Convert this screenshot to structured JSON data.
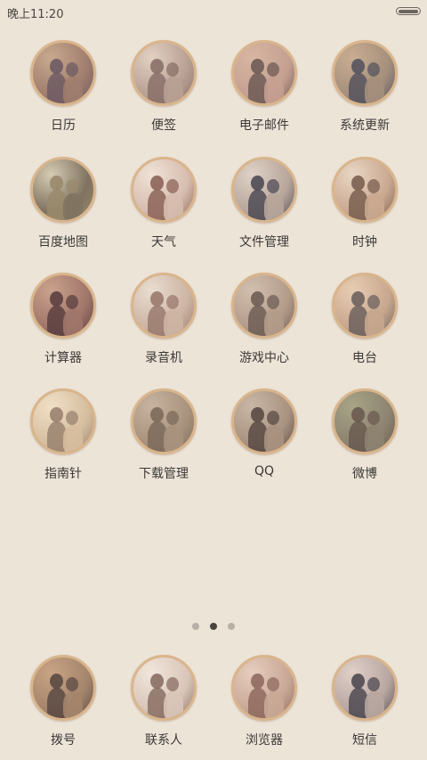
{
  "status_bar": {
    "time": "晚上11:20"
  },
  "pages": {
    "count": 3,
    "active": 1
  },
  "apps": [
    {
      "label": "日历",
      "tint": [
        "#c8a98e",
        "#6d5a63",
        "#a07d6e"
      ]
    },
    {
      "label": "便签",
      "tint": [
        "#e2d1c2",
        "#8a7068",
        "#b89f93"
      ]
    },
    {
      "label": "电子邮件",
      "tint": [
        "#d7b6a2",
        "#6e5b56",
        "#c5a091"
      ]
    },
    {
      "label": "系统更新",
      "tint": [
        "#c9ad92",
        "#56545e",
        "#a58f7c"
      ]
    },
    {
      "label": "百度地图",
      "tint": [
        "#d6cbb3",
        "#9a8a6c",
        "#7f7360"
      ]
    },
    {
      "label": "天气",
      "tint": [
        "#efe2d6",
        "#8c6458",
        "#d6bcae"
      ]
    },
    {
      "label": "文件管理",
      "tint": [
        "#dfd2c6",
        "#4f4b55",
        "#b7a59a"
      ]
    },
    {
      "label": "时钟",
      "tint": [
        "#e8d6c3",
        "#7a5f50",
        "#caa890"
      ]
    },
    {
      "label": "计算器",
      "tint": [
        "#c9a28c",
        "#5b3f40",
        "#a0766a"
      ]
    },
    {
      "label": "录音机",
      "tint": [
        "#e9ddd0",
        "#9a7a6e",
        "#cdb4a3"
      ]
    },
    {
      "label": "游戏中心",
      "tint": [
        "#d2bfae",
        "#6e5e55",
        "#b39b8a"
      ]
    },
    {
      "label": "电台",
      "tint": [
        "#e8cdb3",
        "#6d625e",
        "#c7a78e"
      ]
    },
    {
      "label": "指南针",
      "tint": [
        "#f0dfc6",
        "#9a8270",
        "#d6be9f"
      ]
    },
    {
      "label": "下载管理",
      "tint": [
        "#c7b39f",
        "#7d6a5a",
        "#a8927d"
      ]
    },
    {
      "label": "QQ",
      "tint": [
        "#c9b7a5",
        "#5a4a44",
        "#a89280"
      ]
    },
    {
      "label": "微博",
      "tint": [
        "#a8a486",
        "#6a5a50",
        "#8d8370"
      ]
    }
  ],
  "dock": [
    {
      "label": "拨号",
      "tint": [
        "#c9a384",
        "#5a4a44",
        "#a4856c"
      ]
    },
    {
      "label": "联系人",
      "tint": [
        "#f1e6dc",
        "#8a6e64",
        "#d8c5b8"
      ]
    },
    {
      "label": "浏览器",
      "tint": [
        "#e6cdbd",
        "#8e6a5e",
        "#c9a796"
      ]
    },
    {
      "label": "短信",
      "tint": [
        "#e0d0c8",
        "#4f4a52",
        "#b8a6a0"
      ]
    }
  ]
}
